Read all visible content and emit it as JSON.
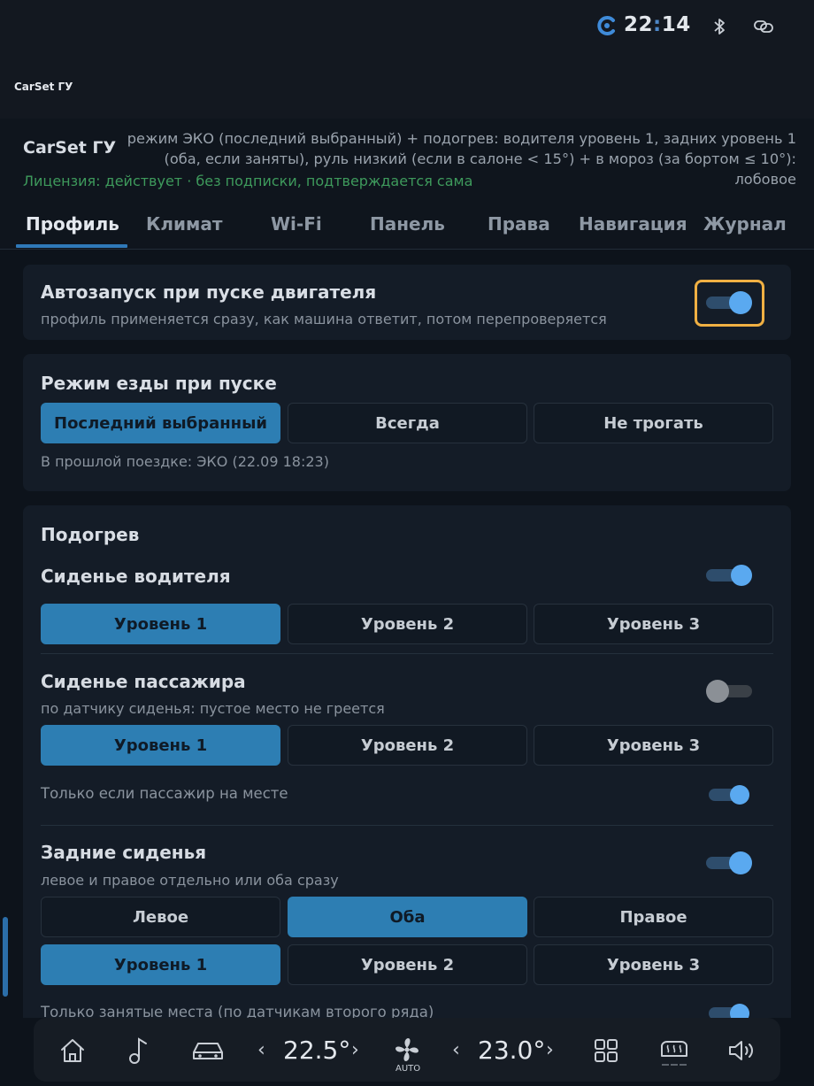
{
  "status": {
    "time_hh": "22",
    "time_mm": "14",
    "app_icon": "c-logo-icon",
    "bluetooth_icon": "bluetooth-icon",
    "link_icon": "link-icon"
  },
  "window": {
    "title": "CarSet ГУ"
  },
  "header": {
    "app_name": "CarSet ГУ",
    "summary_line1": "режим ЭКО (последний выбранный) + подогрев: водителя уровень 1, задних уровень 1",
    "summary_line2": "(оба, если заняты), руль низкий (если в салоне < 15°) + в мороз (за бортом ≤ 10°): лобовое",
    "license": "Лицензия: действует · без подписки, подтверждается сама"
  },
  "tabs": [
    "Профиль",
    "Климат",
    "Wi-Fi",
    "Панель",
    "Права",
    "Навигация",
    "Журнал"
  ],
  "autostart": {
    "title": "Автозапуск при пуске двигателя",
    "subtitle": "профиль применяется сразу, как машина ответит, потом перепроверяется",
    "enabled": true
  },
  "drive_mode": {
    "title": "Режим езды при пуске",
    "options": [
      "Последний выбранный",
      "Всегда",
      "Не трогать"
    ],
    "selected": "Последний выбранный",
    "note": "В прошлой поездке: ЭКО (22.09 18:23)"
  },
  "heating": {
    "title": "Подогрев",
    "driver": {
      "label": "Сиденье водителя",
      "enabled": true,
      "levels": [
        "Уровень 1",
        "Уровень 2",
        "Уровень 3"
      ],
      "selected": "Уровень 1"
    },
    "passenger": {
      "label": "Сиденье пассажира",
      "subtitle": "по датчику сиденья: пустое место не греется",
      "enabled": false,
      "levels": [
        "Уровень 1",
        "Уровень 2",
        "Уровень 3"
      ],
      "selected": "Уровень 1",
      "only_if_present_label": "Только если пассажир на месте",
      "only_if_present": true
    },
    "rear": {
      "label": "Задние сиденья",
      "subtitle": "левое и правое отдельно или оба сразу",
      "enabled": true,
      "sides": [
        "Левое",
        "Оба",
        "Правое"
      ],
      "selected_side": "Оба",
      "levels": [
        "Уровень 1",
        "Уровень 2",
        "Уровень 3"
      ],
      "selected": "Уровень 1",
      "occupied_only_label": "Только занятые места (по датчикам второго ряда)",
      "occupied_only": true
    }
  },
  "dock": {
    "icons": [
      "home-icon",
      "music-icon",
      "car-icon",
      "fan-icon",
      "apps-grid-icon",
      "rear-defrost-icon",
      "volume-icon"
    ],
    "temp_left": "22.5°",
    "temp_right": "23.0°",
    "fan_label": "AUTO",
    "chev_left": "‹",
    "chev_right": "›"
  },
  "colors": {
    "accent": "#2d7eb3",
    "focus": "#f0b043",
    "license_green": "#3e9a5c",
    "toggle_on": "#5aa9f0"
  }
}
